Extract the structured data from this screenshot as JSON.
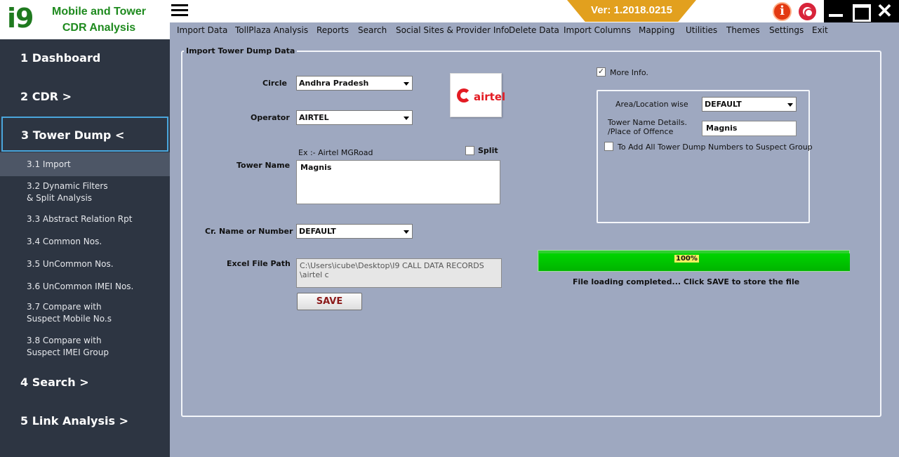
{
  "app": {
    "logo_mark": "i9",
    "title_line1": "Mobile and Tower",
    "title_line2": "CDR Analysis",
    "version": "Ver: 1.2018.0215",
    "icons": {
      "menu": "hamburger-icon",
      "info": "info-icon",
      "help": "lifebuoy-icon",
      "minimize": "minimize-icon",
      "maximize": "maximize-icon",
      "close": "close-icon"
    },
    "info_glyph": "i",
    "close_glyph": "✕"
  },
  "menubar": {
    "items": [
      "Import Data",
      "TollPlaza Analysis",
      "Reports",
      "Search",
      "Social Sites & Provider Info",
      "Delete Data",
      "Import Columns",
      "Mapping",
      "Utilities",
      "Themes",
      "Settings",
      "Exit"
    ]
  },
  "sidebar": {
    "main_items": [
      "1 Dashboard",
      "2 CDR >",
      "3 Tower Dump <",
      "4 Search >",
      "5 Link Analysis >"
    ],
    "active_main": "3 Tower Dump <",
    "sub_items": [
      "3.1 Import",
      "3.2 Dynamic Filters\n& Split Analysis",
      "3.3 Abstract Relation Rpt",
      "3.4 Common Nos.",
      "3.5 UnCommon Nos.",
      "3.6 UnCommon IMEI Nos.",
      "3.7 Compare with\nSuspect Mobile No.s",
      "3.8 Compare with\nSuspect IMEI Group"
    ],
    "active_sub": "3.1 Import"
  },
  "form": {
    "group_title": "Import Tower Dump Data",
    "circle": {
      "label": "Circle",
      "value": "Andhra Pradesh"
    },
    "operator": {
      "label": "Operator",
      "value": "AIRTEL"
    },
    "operator_logo_text": "airtel",
    "tower_name": {
      "label": "Tower Name",
      "hint": "Ex :-  Airtel MGRoad",
      "value": "Magnis"
    },
    "split": {
      "label": "Split",
      "checked": false
    },
    "cr_name": {
      "label": "Cr. Name or Number",
      "value": "DEFAULT"
    },
    "excel_path": {
      "label": "Excel File Path",
      "value": "C:\\Users\\icube\\Desktop\\I9 CALL DATA RECORDS\n\\airtel c"
    },
    "save_label": "SAVE",
    "more_info": {
      "label": "More Info.",
      "checked": true,
      "check_glyph": "✓"
    },
    "area_location": {
      "label": "Area/Location wise",
      "value": "DEFAULT"
    },
    "tower_details": {
      "label_line1": "Tower Name Details.",
      "label_line2": "/Place of Offence",
      "value": "Magnis"
    },
    "add_suspect": {
      "label": "To Add All Tower Dump Numbers to Suspect Group",
      "checked": false
    },
    "progress": {
      "percent": 100,
      "label": "100%"
    },
    "status_text": "File loading completed... Click SAVE to store the file",
    "colors": {
      "accent": "#e2a01e",
      "progress": "#00c400",
      "sidebar": "#2d3542",
      "panel": "#9ea8c0",
      "brand_green": "#1e8a1e",
      "airtel_red": "#e31b23"
    }
  }
}
